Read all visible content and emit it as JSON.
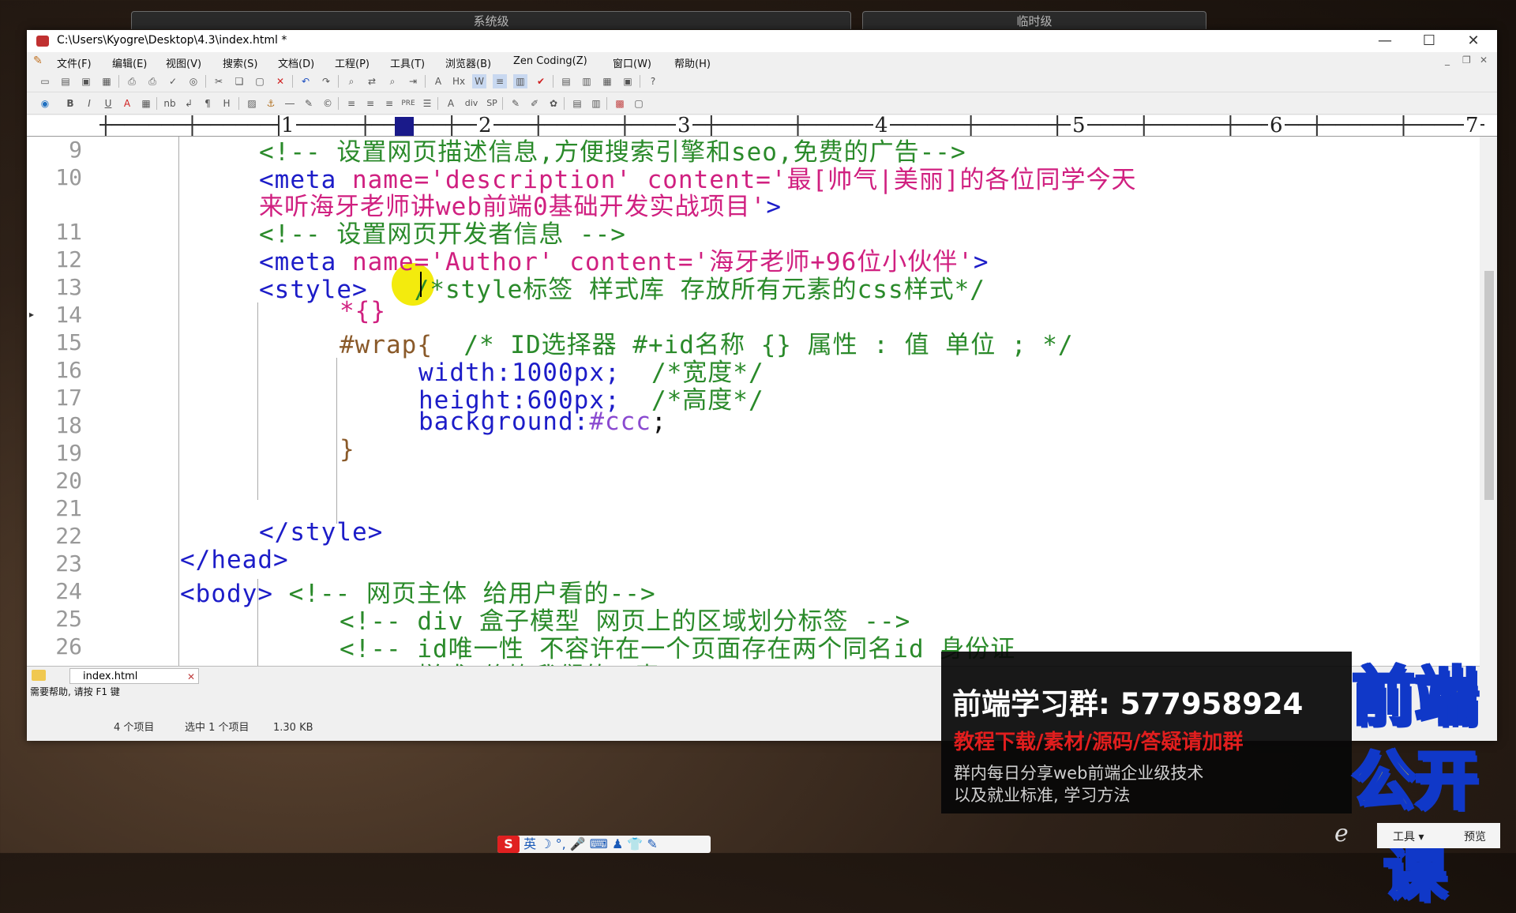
{
  "desktop": {
    "tab1": "系统级",
    "tab2": "临时级"
  },
  "window": {
    "title": "C:\\Users\\Kyogre\\Desktop\\4.3\\index.html *",
    "min": "—",
    "max": "☐",
    "close": "✕"
  },
  "menus": [
    "文件(F)",
    "编辑(E)",
    "视图(V)",
    "搜索(S)",
    "文档(D)",
    "工程(P)",
    "工具(T)",
    "浏览器(B)",
    "Zen Coding(Z)",
    "窗口(W)",
    "帮助(H)"
  ],
  "ruler": {
    "numbers": [
      "1",
      "2",
      "3",
      "4",
      "5",
      "6",
      "7"
    ]
  },
  "gutter": {
    "line_numbers": [
      "9",
      "10",
      "",
      "11",
      "12",
      "13",
      "14",
      "15",
      "16",
      "17",
      "18",
      "19",
      "20",
      "21",
      "22",
      "23",
      "24",
      "25",
      "26"
    ]
  },
  "code": {
    "l9": "<!-- 设置网页描述信息,方便搜索引擎和seo,免费的广告-->",
    "l10_tag": "<meta ",
    "l10_attr": "name='description' content='最[帅气|美丽]的各位同学今天",
    "l10b": "来听海牙老师讲web前端0基础开发实战项目'",
    "l10b_end": ">",
    "l11": "<!-- 设置网页开发者信息 -->",
    "l12_tag": "<meta ",
    "l12_attr": "name='Author' content='海牙老师+96位小伙伴'",
    "l12_end": ">",
    "l13_tag": "<style>",
    "l13_comment": "/*style标签 样式库 存放所有元素的css样式*/",
    "l14": "*{}",
    "l15_sel": "#wrap{",
    "l15_comment": "/* ID选择器 #+id名称 {} 属性 : 值 单位 ; */",
    "l16_prop": "width:1000px;",
    "l16_comment": "/*宽度*/",
    "l17_prop": "height:600px;",
    "l17_comment": "/*高度*/",
    "l18_prop": "background:",
    "l18_val": "#ccc",
    "l18_end": ";",
    "l19": "}",
    "l22": "</style>",
    "l23": "</head>",
    "l24_tag": "<body>",
    "l24_comment": "<!-- 网页主体 给用户看的-->",
    "l25": "<!-- div 盒子模型 网页上的区域划分标签 -->",
    "l26": "<!-- id唯一性 不容许在一个页面存在两个同名id 身份证",
    "l27": "<!-- 样式 修饰我们的元素 -->"
  },
  "doc_tab": {
    "label": "index.html",
    "close": "✕"
  },
  "statusbar": {
    "help": "需要帮助, 请按 F1 键"
  },
  "explorer_status": {
    "items": "4 个项目",
    "selected": "选中 1 个项目",
    "size": "1.30 KB"
  },
  "promo": {
    "title": "前端学习群: 577958924",
    "red": "教程下载/素材/源码/答疑请加群",
    "line1": "群内每日分享web前端企业级技术",
    "line2": "以及就业标准, 学习方法"
  },
  "badge": {
    "line1": "前端",
    "line2": "公开课"
  },
  "taskbar": {
    "ime_logo": "S",
    "ime_lang": "英 ☽ °, 🎤 ⌨ ♟ 👕 ✎",
    "ie": "e",
    "tools": "工具 ▾",
    "preview": "预览"
  },
  "colors": {
    "tag": "#1c1cc8",
    "attr": "#d02080",
    "comment": "#2a8a2a",
    "selector": "#8a5a2a",
    "value": "#8a4ad0"
  }
}
